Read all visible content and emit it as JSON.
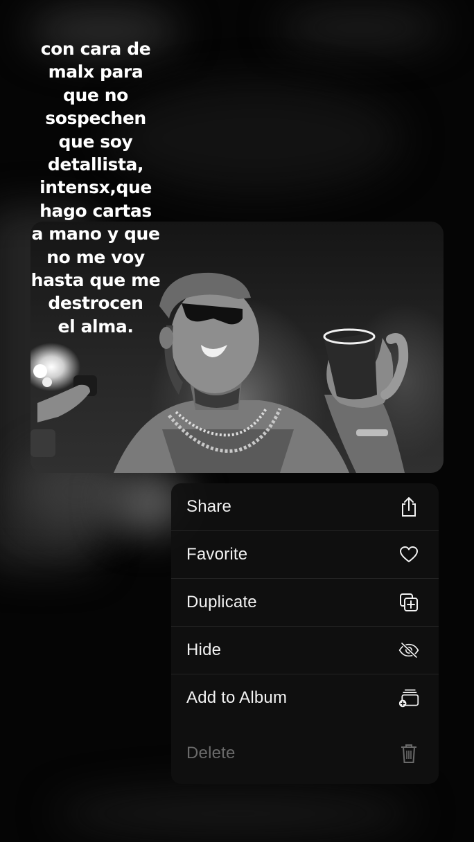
{
  "caption": {
    "lines": [
      "con cara de",
      "malx para",
      "que no",
      "sospechen",
      "que soy",
      "detallista,",
      "intensx,que",
      "hago cartas",
      "a mano y que",
      "no me voy",
      "hasta que me",
      "destrocen",
      "el alma."
    ]
  },
  "menu": {
    "items": [
      {
        "label": "Share",
        "icon": "share-icon"
      },
      {
        "label": "Favorite",
        "icon": "heart-icon"
      },
      {
        "label": "Duplicate",
        "icon": "duplicate-icon"
      },
      {
        "label": "Hide",
        "icon": "eye-slash-icon"
      },
      {
        "label": "Add to Album",
        "icon": "add-to-album-icon"
      },
      {
        "label": "Delete",
        "icon": "trash-icon",
        "disabled": true
      }
    ]
  },
  "colors": {
    "menu_text": "#f2f2f2",
    "menu_disabled": "#6a6a6a",
    "menu_bg": "#101010"
  }
}
